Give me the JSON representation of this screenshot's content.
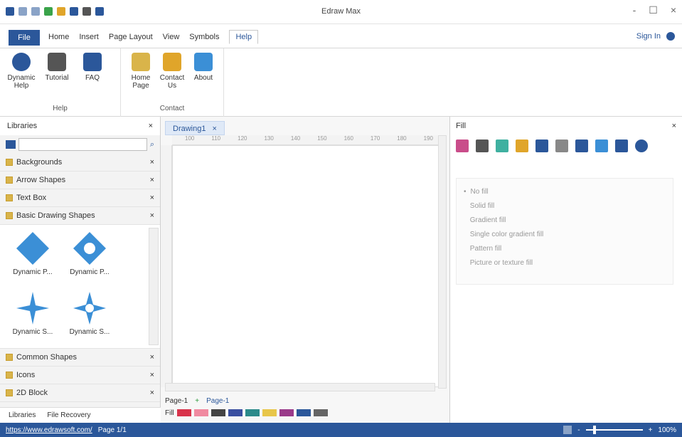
{
  "window": {
    "title": "Edraw Max",
    "controls": [
      "-",
      "☐",
      "×"
    ]
  },
  "menu": {
    "file_label": "File",
    "tabs": [
      "Home",
      "Insert",
      "Page Layout",
      "View",
      "Symbols",
      "Help"
    ],
    "active_tab": "Help",
    "sign_in": "Sign In"
  },
  "ribbon": {
    "help_group": {
      "label": "Help",
      "buttons": [
        {
          "label": "Dynamic Help",
          "icon": "help-circle-icon"
        },
        {
          "label": "Tutorial",
          "icon": "film-strip-icon"
        },
        {
          "label": "FAQ",
          "icon": "faq-icon"
        }
      ]
    },
    "contact_group": {
      "label": "Contact",
      "buttons": [
        {
          "label": "Home Page",
          "icon": "home-icon"
        },
        {
          "label": "Contact Us",
          "icon": "contact-icon"
        },
        {
          "label": "About",
          "icon": "about-icon"
        }
      ]
    }
  },
  "libraries": {
    "title": "Libraries",
    "items": [
      {
        "label": "Backgrounds"
      },
      {
        "label": "Arrow Shapes"
      },
      {
        "label": "Text Box"
      },
      {
        "label": "Basic Drawing Shapes"
      },
      {
        "label": "Common Shapes"
      },
      {
        "label": "Icons"
      },
      {
        "label": "2D Block"
      }
    ],
    "shapes": [
      "Dynamic P...",
      "Dynamic P...",
      "Dynamic S...",
      "Dynamic S..."
    ],
    "bottom_tabs": [
      "Libraries",
      "File Recovery"
    ]
  },
  "document": {
    "tab_label": "Drawing1",
    "ruler_ticks": [
      "100",
      "110",
      "120",
      "130",
      "140",
      "150",
      "160",
      "170",
      "180",
      "190"
    ],
    "page_tab": "Page-1",
    "page_tab_active": "Page-1",
    "fill_label": "Fill"
  },
  "fill": {
    "title": "Fill",
    "options": [
      "No fill",
      "Solid fill",
      "Gradient fill",
      "Single color gradient fill",
      "Pattern fill",
      "Picture or texture fill"
    ]
  },
  "status": {
    "url": "https://www.edrawsoft.com/",
    "page": "Page 1/1",
    "zoom": "100%"
  },
  "colors": {
    "accent": "#2b579a",
    "diamond": "#3b8fd6",
    "folder": "#d9b44a"
  }
}
